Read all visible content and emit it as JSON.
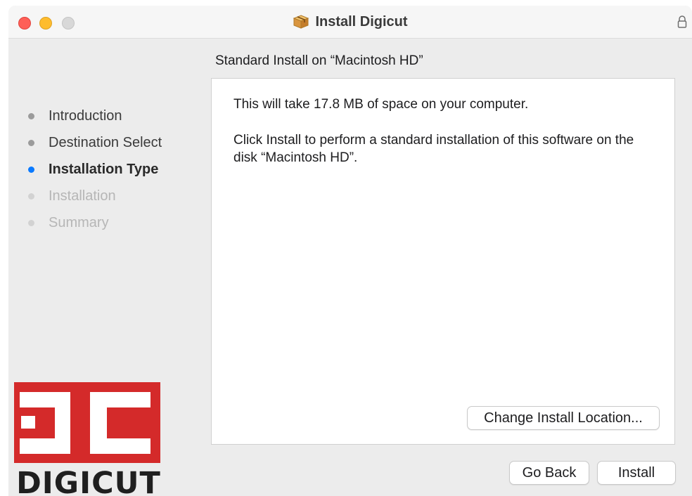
{
  "window": {
    "title": "Install Digicut"
  },
  "pane": {
    "title": "Standard Install on “Macintosh HD”"
  },
  "steps": [
    {
      "label": "Introduction",
      "state": "done"
    },
    {
      "label": "Destination Select",
      "state": "done"
    },
    {
      "label": "Installation Type",
      "state": "active"
    },
    {
      "label": "Installation",
      "state": "todo"
    },
    {
      "label": "Summary",
      "state": "todo"
    }
  ],
  "content": {
    "space_text": "This will take 17.8 MB of space on your computer.",
    "install_text": "Click Install to perform a standard installation of this software on the disk “Macintosh HD”."
  },
  "buttons": {
    "change_location": "Change Install Location...",
    "go_back": "Go Back",
    "install": "Install"
  },
  "logo": {
    "text": "DIGICUT",
    "brand_color": "#d42a2a"
  },
  "icons": {
    "title": "package-icon",
    "lock": "lock-icon"
  },
  "colors": {
    "active_step": "#0a7aff",
    "close": "#fe5f57",
    "minimize": "#febc2e",
    "maximize": "#d8d8d8"
  }
}
